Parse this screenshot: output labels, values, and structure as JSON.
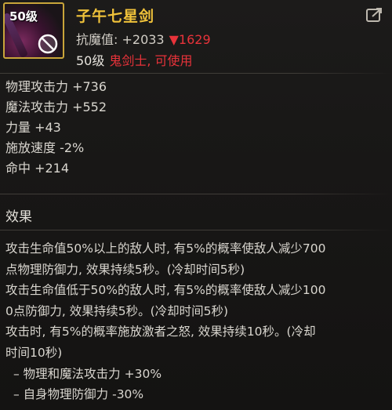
{
  "item": {
    "level_badge": "50级",
    "name": "子午七星剑",
    "resist_label": "抗魔值: +2033",
    "resist_change": "▼1629",
    "req_level": "50级",
    "req_class": "鬼剑士, 可使用"
  },
  "stats": [
    "物理攻击力 +736",
    "魔法攻击力 +552",
    "力量 +43",
    "施放速度 -2%",
    "命中 +214"
  ],
  "effect": {
    "title": "效果",
    "lines": [
      "攻击生命值50%以上的敌人时, 有5%的概率使敌人减少700",
      "点物理防御力, 效果持续5秒。(冷却时间5秒)",
      "攻击生命值低于50%的敌人时, 有5%的概率使敌人减少100",
      "0点防御力, 效果持续5秒。(冷却时间5秒)",
      "攻击时, 有5%的概率施放激者之怒, 效果持续10秒。(冷却",
      "时间10秒)",
      "– 物理和魔法攻击力 +30%",
      "– 自身物理防御力 -30%"
    ]
  },
  "colors": {
    "name": "#f0c23a",
    "red": "#e8333a",
    "icon_border": "#c9a53a"
  },
  "icons": {
    "ban": "prohibited-icon",
    "share": "share-icon"
  }
}
